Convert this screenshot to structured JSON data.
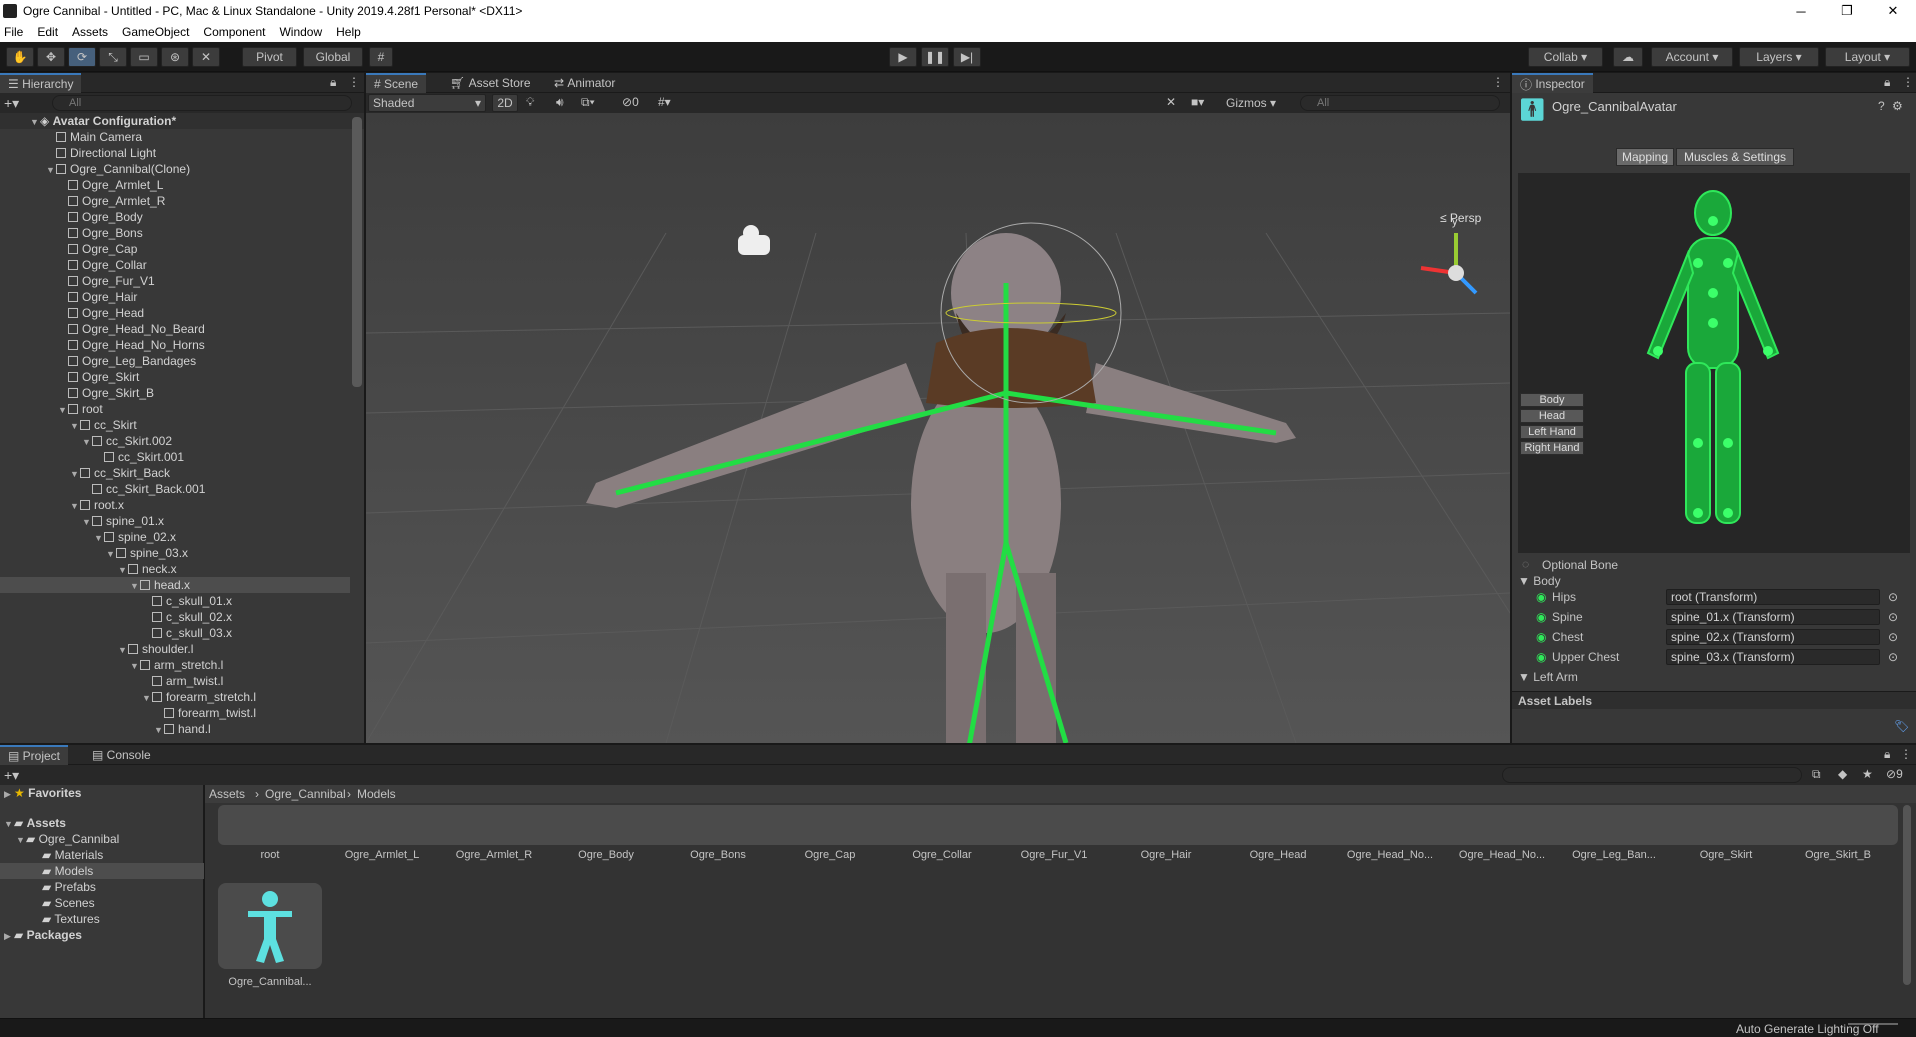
{
  "window": {
    "title": "Ogre Cannibal - Untitled - PC, Mac & Linux Standalone - Unity 2019.4.28f1 Personal* <DX11>",
    "minimize": "─",
    "maximize": "❐",
    "close": "✕"
  },
  "menu": [
    "File",
    "Edit",
    "Assets",
    "GameObject",
    "Component",
    "Window",
    "Help"
  ],
  "toolbar": {
    "pivot": "Pivot",
    "global": "Global",
    "collab": "Collab ▾",
    "account": "Account",
    "layers": "Layers",
    "layout": "Layout"
  },
  "hierarchy": {
    "tab": "Hierarchy",
    "search_placeholder": "All",
    "scene": "Avatar Configuration*",
    "rows": [
      {
        "label": "Main Camera",
        "indent": 3,
        "arrow": ""
      },
      {
        "label": "Directional Light",
        "indent": 3,
        "arrow": ""
      },
      {
        "label": "Ogre_Cannibal(Clone)",
        "indent": 3,
        "arrow": "▼"
      },
      {
        "label": "Ogre_Armlet_L",
        "indent": 4,
        "arrow": ""
      },
      {
        "label": "Ogre_Armlet_R",
        "indent": 4,
        "arrow": ""
      },
      {
        "label": "Ogre_Body",
        "indent": 4,
        "arrow": ""
      },
      {
        "label": "Ogre_Bons",
        "indent": 4,
        "arrow": ""
      },
      {
        "label": "Ogre_Cap",
        "indent": 4,
        "arrow": ""
      },
      {
        "label": "Ogre_Collar",
        "indent": 4,
        "arrow": ""
      },
      {
        "label": "Ogre_Fur_V1",
        "indent": 4,
        "arrow": ""
      },
      {
        "label": "Ogre_Hair",
        "indent": 4,
        "arrow": ""
      },
      {
        "label": "Ogre_Head",
        "indent": 4,
        "arrow": ""
      },
      {
        "label": "Ogre_Head_No_Beard",
        "indent": 4,
        "arrow": ""
      },
      {
        "label": "Ogre_Head_No_Horns",
        "indent": 4,
        "arrow": ""
      },
      {
        "label": "Ogre_Leg_Bandages",
        "indent": 4,
        "arrow": ""
      },
      {
        "label": "Ogre_Skirt",
        "indent": 4,
        "arrow": ""
      },
      {
        "label": "Ogre_Skirt_B",
        "indent": 4,
        "arrow": ""
      },
      {
        "label": "root",
        "indent": 4,
        "arrow": "▼"
      },
      {
        "label": "cc_Skirt",
        "indent": 5,
        "arrow": "▼"
      },
      {
        "label": "cc_Skirt.002",
        "indent": 6,
        "arrow": "▼"
      },
      {
        "label": "cc_Skirt.001",
        "indent": 7,
        "arrow": ""
      },
      {
        "label": "cc_Skirt_Back",
        "indent": 5,
        "arrow": "▼"
      },
      {
        "label": "cc_Skirt_Back.001",
        "indent": 6,
        "arrow": ""
      },
      {
        "label": "root.x",
        "indent": 5,
        "arrow": "▼"
      },
      {
        "label": "spine_01.x",
        "indent": 6,
        "arrow": "▼"
      },
      {
        "label": "spine_02.x",
        "indent": 7,
        "arrow": "▼"
      },
      {
        "label": "spine_03.x",
        "indent": 8,
        "arrow": "▼"
      },
      {
        "label": "neck.x",
        "indent": 9,
        "arrow": "▼"
      },
      {
        "label": "head.x",
        "indent": 10,
        "arrow": "▼"
      },
      {
        "label": "c_skull_01.x",
        "indent": 11,
        "arrow": ""
      },
      {
        "label": "c_skull_02.x",
        "indent": 11,
        "arrow": ""
      },
      {
        "label": "c_skull_03.x",
        "indent": 11,
        "arrow": ""
      },
      {
        "label": "shoulder.l",
        "indent": 9,
        "arrow": "▼"
      },
      {
        "label": "arm_stretch.l",
        "indent": 10,
        "arrow": "▼"
      },
      {
        "label": "arm_twist.l",
        "indent": 11,
        "arrow": ""
      },
      {
        "label": "forearm_stretch.l",
        "indent": 11,
        "arrow": "▼"
      },
      {
        "label": "forearm_twist.l",
        "indent": 12,
        "arrow": ""
      },
      {
        "label": "hand.l",
        "indent": 12,
        "arrow": "▼"
      }
    ]
  },
  "scene": {
    "tabs": [
      "Scene",
      "Asset Store",
      "Animator"
    ],
    "shading": "Shaded",
    "mode2d": "2D",
    "hidden_count": "0",
    "gizmos": "Gizmos",
    "search_placeholder": "All",
    "persp": "≤ Persp"
  },
  "inspector": {
    "tab": "Inspector",
    "asset_name": "Ogre_CannibalAvatar",
    "mapping": "Mapping",
    "muscles": "Muscles & Settings",
    "body_buttons": [
      "Body",
      "Head",
      "Left Hand",
      "Right Hand"
    ],
    "optional_bone": "Optional Bone",
    "section_body": "Body",
    "bones": [
      {
        "name": "Hips",
        "value": "root (Transform)"
      },
      {
        "name": "Spine",
        "value": "spine_01.x (Transform)"
      },
      {
        "name": "Chest",
        "value": "spine_02.x (Transform)"
      },
      {
        "name": "Upper Chest",
        "value": "spine_03.x (Transform)"
      }
    ],
    "section_left_arm": "Left Arm",
    "asset_labels": "Asset Labels"
  },
  "project": {
    "tabs": [
      "Project",
      "Console"
    ],
    "favorites": "Favorites",
    "assets": "Assets",
    "ogre": "Ogre_Cannibal",
    "folders": [
      "Materials",
      "Models",
      "Prefabs",
      "Scenes",
      "Textures"
    ],
    "packages": "Packages",
    "breadcrumb": [
      "Assets",
      "Ogre_Cannibal",
      "Models"
    ],
    "hidden_count": "9",
    "items": [
      "root",
      "Ogre_Armlet_L",
      "Ogre_Armlet_R",
      "Ogre_Body",
      "Ogre_Bons",
      "Ogre_Cap",
      "Ogre_Collar",
      "Ogre_Fur_V1",
      "Ogre_Hair",
      "Ogre_Head",
      "Ogre_Head_No...",
      "Ogre_Head_No...",
      "Ogre_Leg_Ban...",
      "Ogre_Skirt",
      "Ogre_Skirt_B"
    ],
    "avatar_item": "Ogre_Cannibal..."
  },
  "status": {
    "lighting": "Auto Generate Lighting Off"
  }
}
